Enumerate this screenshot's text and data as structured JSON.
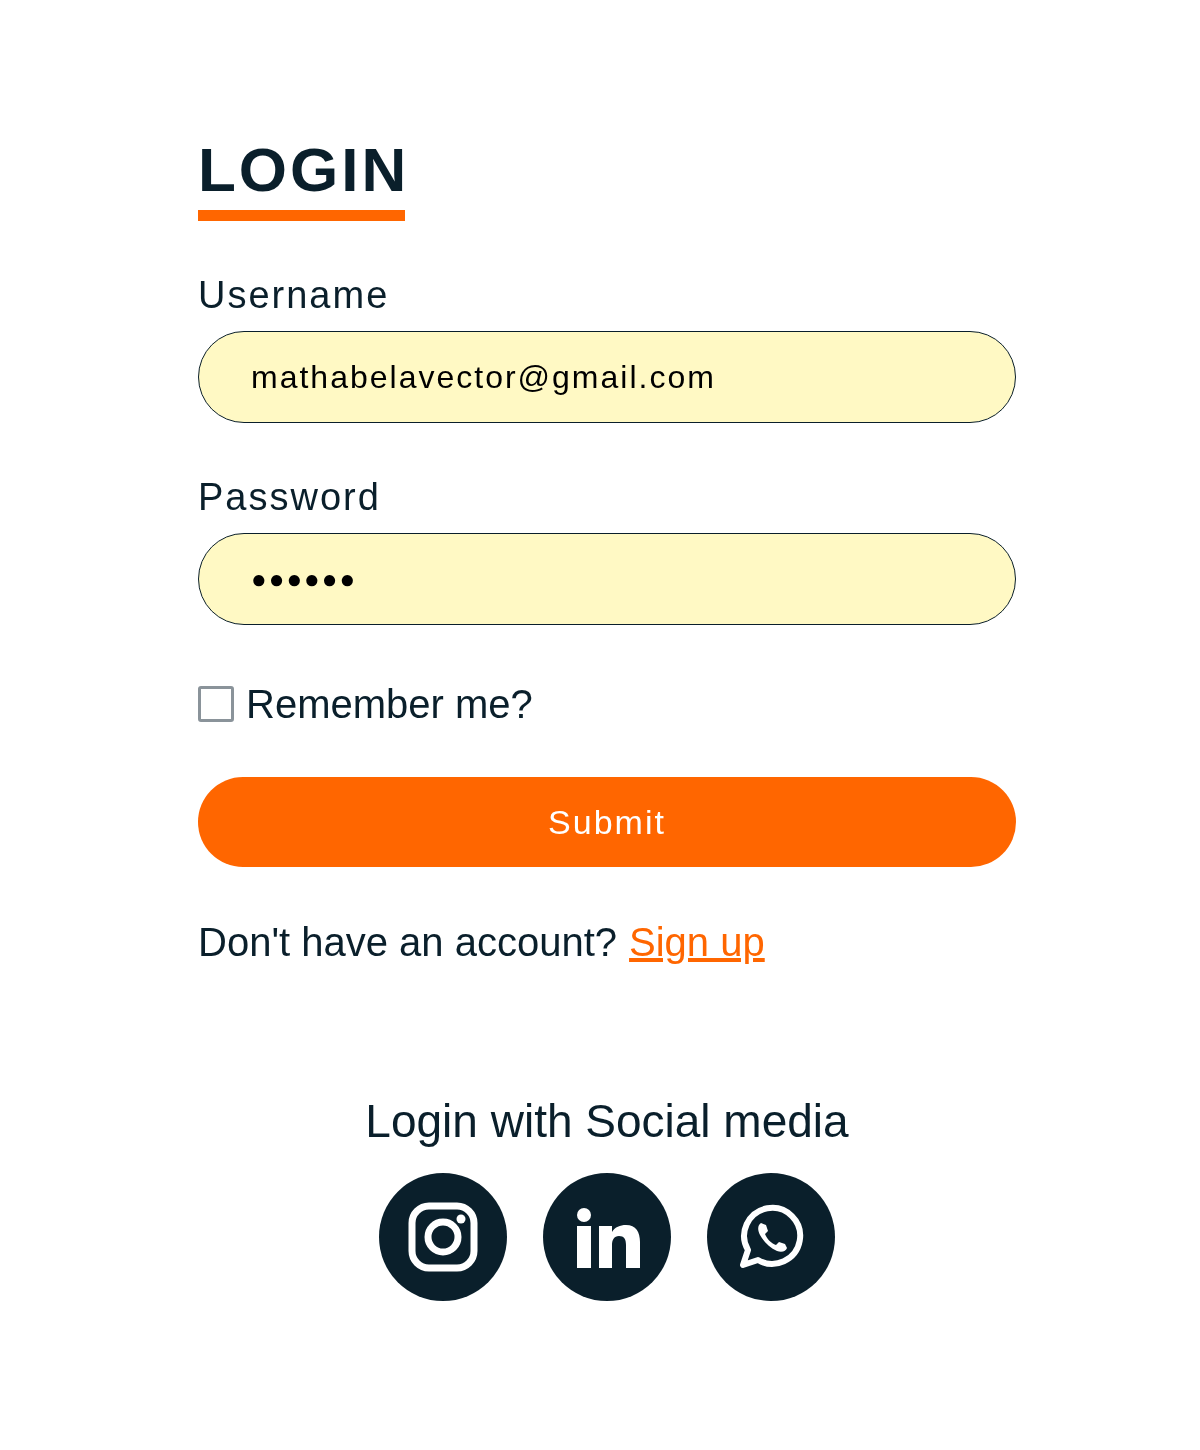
{
  "title": "LOGIN",
  "username": {
    "label": "Username",
    "value": "mathabelavector@gmail.com"
  },
  "password": {
    "label": "Password",
    "value": "●●●●●●"
  },
  "remember": {
    "label": "Remember me?",
    "checked": false
  },
  "submit": "Submit",
  "signup": {
    "text": "Don't have an account?",
    "link": "Sign up"
  },
  "social": {
    "heading": "Login with Social media",
    "icons": [
      {
        "kind": "instagram"
      },
      {
        "kind": "linkedin"
      },
      {
        "kind": "whatsapp"
      }
    ]
  }
}
